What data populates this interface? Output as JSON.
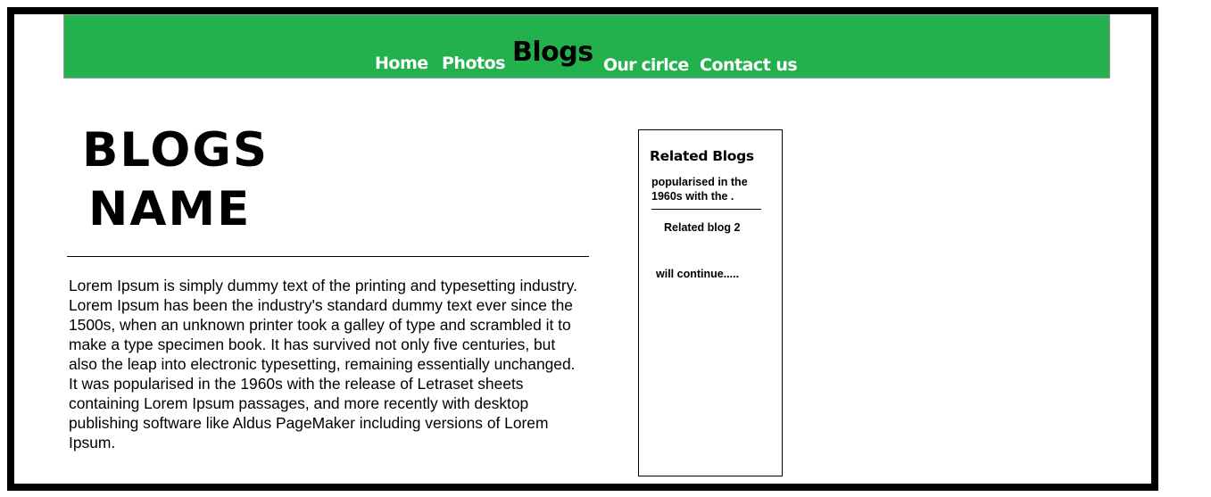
{
  "nav": {
    "items": [
      {
        "label": "Home"
      },
      {
        "label": "Photos"
      },
      {
        "label": "Blogs"
      },
      {
        "label": "Our cirlce"
      },
      {
        "label": "Contact us"
      }
    ],
    "active": "Blogs"
  },
  "blog": {
    "title_line1": "BLOGS",
    "title_line2": "NAME",
    "body": "Lorem Ipsum is simply dummy text of the printing and typesetting industry. Lorem Ipsum has been the industry's standard dummy text ever since the 1500s, when an unknown printer took a galley of type and scrambled it to make a type specimen book. It has survived not only five centuries, but also the leap into electronic typesetting, remaining essentially unchanged. It was popularised in the 1960s with the release of Letraset sheets containing Lorem Ipsum passages, and more recently with desktop publishing software like Aldus PageMaker including versions of Lorem Ipsum."
  },
  "related": {
    "heading": "Related Blogs",
    "item1": "popularised in the 1960s with the .",
    "item2": "Related blog 2",
    "more": "will continue....."
  },
  "colors": {
    "navbar_bg": "#22b14c",
    "nav_text": "#ffffff",
    "nav_active_text": "#000000",
    "frame_border": "#000000"
  }
}
